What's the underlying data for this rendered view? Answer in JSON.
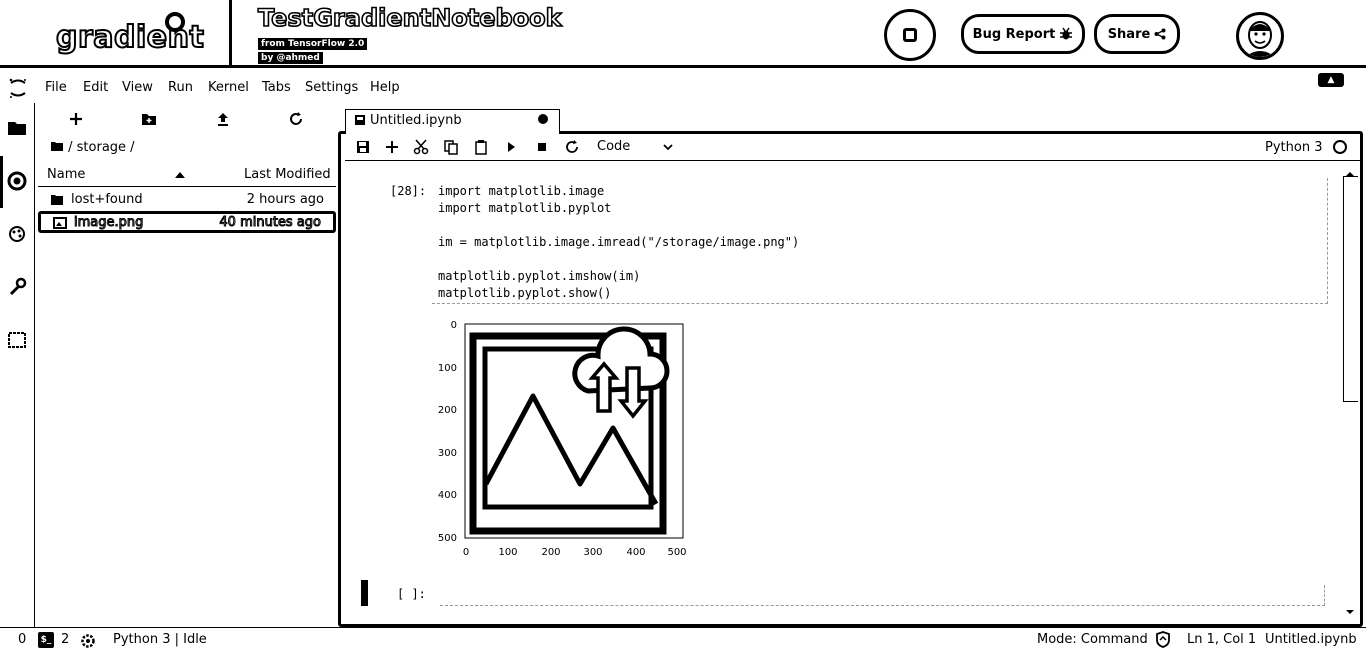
{
  "header": {
    "logo_text": "gradient",
    "notebook_title": "TestGradientNotebook",
    "subtitle": "from TensorFlow 2.0",
    "author": "by @ahmed",
    "bug_report_label": "Bug Report",
    "share_label": "Share"
  },
  "menu": {
    "items": [
      "File",
      "Edit",
      "View",
      "Run",
      "Kernel",
      "Tabs",
      "Settings",
      "Help"
    ]
  },
  "filebrowser": {
    "breadcrumb": "/ storage /",
    "col_name": "Name",
    "col_modified": "Last Modified",
    "files": [
      {
        "name": "lost+found",
        "modified": "2 hours ago"
      },
      {
        "name": "image.png",
        "modified": "40 minutes ago"
      }
    ]
  },
  "notebook": {
    "tab_label": "Untitled.ipynb",
    "cell_type": "Code",
    "kernel": "Python 3",
    "cell1": {
      "prompt": "[28]:",
      "lines": [
        "import matplotlib.image",
        "import matplotlib.pyplot",
        "",
        "im = matplotlib.image.imread(\"/storage/image.png\")",
        "",
        "matplotlib.pyplot.imshow(im)",
        "matplotlib.pyplot.show()"
      ]
    },
    "cell2": {
      "prompt": "[ ]:"
    }
  },
  "plot": {
    "yticks": [
      "0",
      "100",
      "200",
      "300",
      "400",
      "500"
    ],
    "xticks": [
      "0",
      "100",
      "200",
      "300",
      "400",
      "500"
    ]
  },
  "status": {
    "terminals": "0",
    "kernels": "2",
    "kernel_state": "Python 3 | Idle",
    "mode": "Mode: Command",
    "cursor": "Ln 1, Col 1",
    "file": "Untitled.ipynb"
  }
}
